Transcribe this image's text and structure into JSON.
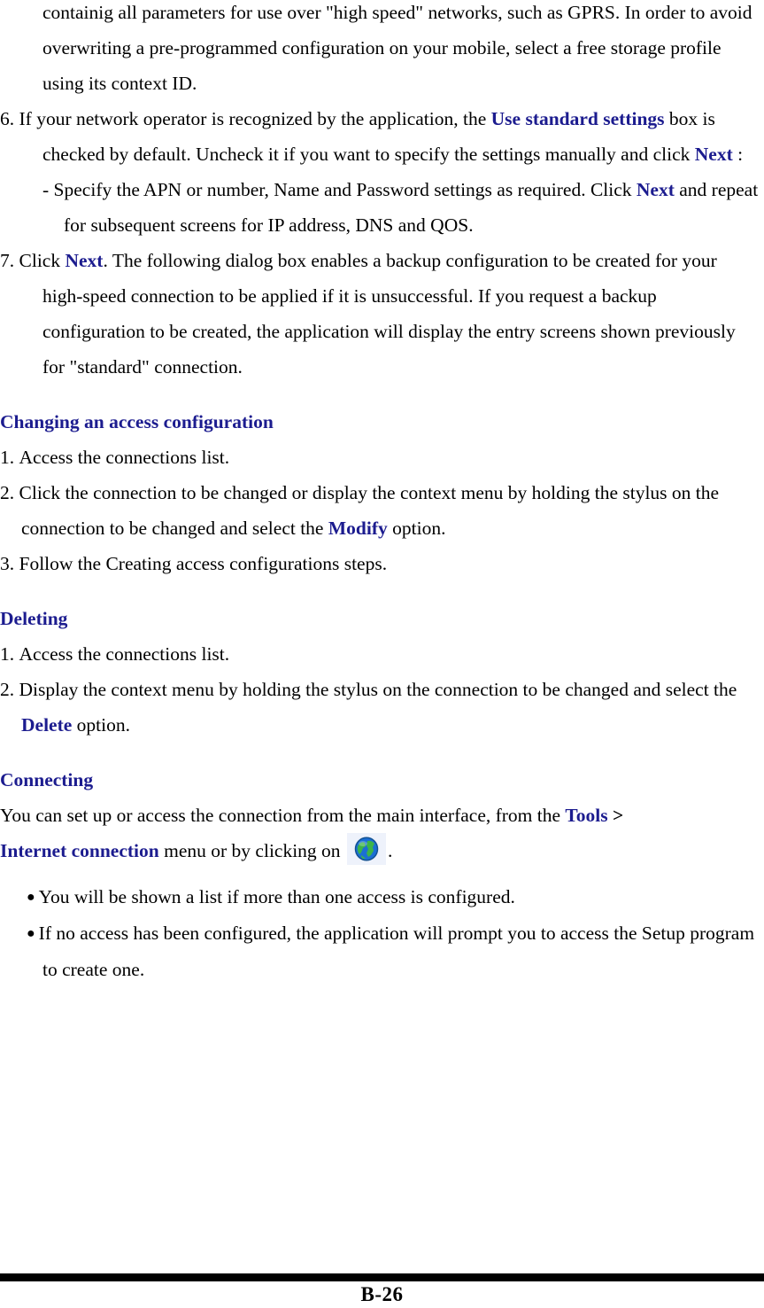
{
  "document": {
    "page_label": "B-26"
  },
  "body": {
    "continued_paragraph": {
      "line_1": "containig all parameters for use over \"high speed\" networks, such as GPRS. In",
      "line_2": "order to avoid overwriting a pre-programmed configuration on your mobile,",
      "line_3": "select a free storage profile using its context ID.",
      "full_text": "containig all parameters for use over \"high speed\" networks, such as GPRS. In order to avoid overwriting a pre-programmed configuration on your mobile, select a free storage profile using its context ID."
    },
    "step_6": {
      "number": "6.",
      "text_before_bold_1": "If your network operator is recognized by the application, the ",
      "bold_1": "Use standard settings",
      "text_middle": " box is checked by default. Uncheck it if you want to specify the settings manually and click ",
      "bold_2": "Next",
      "text_after": " :",
      "sub_item": {
        "dash": "-",
        "text_before_bold": "Specify the APN or number, Name and Password settings as required. Click ",
        "bold": "Next",
        "text_after": " and repeat for subsequent screens for IP address, DNS and QOS."
      }
    },
    "step_7": {
      "number": "7.",
      "text_before_bold": "Click ",
      "bold": "Next",
      "text_after": ". The following dialog box enables a backup configuration to be created for your high-speed connection to be applied if it is unsuccessful. If you request a backup configuration to be created, the application will display the entry screens shown previously for \"standard\" connection."
    },
    "section_changing": {
      "heading": "Changing an access configuration",
      "item_1": {
        "number": "1.",
        "text": "Access the connections list."
      },
      "item_2": {
        "number": "2.",
        "text_before_bold": "Click the connection to be changed or display the context menu by holding the stylus on the connection to be changed and select the ",
        "bold": "Modify",
        "text_after": " option."
      },
      "item_3": {
        "number": "3.",
        "text": "Follow the Creating access configurations steps."
      }
    },
    "section_deleting": {
      "heading": "Deleting",
      "item_1": {
        "number": "1.",
        "text": "Access the connections list."
      },
      "item_2": {
        "number": "2.",
        "text_before_bold": "Display the context menu by holding the stylus on the connection to be changed and select the ",
        "bold": "Delete",
        "text_after": " option."
      }
    },
    "section_connecting": {
      "heading": "Connecting",
      "paragraph": {
        "text_before_bold_1": "You can set up or access the connection from the main interface, from the ",
        "bold_1": "Tools",
        "separator": " >",
        "bold_2": "Internet connection",
        "text_middle": " menu or by clicking on ",
        "icon_name": "globe-icon",
        "text_after": "."
      },
      "bullets": [
        {
          "marker": "●",
          "text": "You will be shown a list if more than one access is configured."
        },
        {
          "marker": "●",
          "text": "If no access has been configured, the application will prompt you to access the Setup program to create one."
        }
      ]
    }
  },
  "colors": {
    "heading_blue": "#1c1c8f",
    "body_black": "#000000",
    "page_background": "#ffffff",
    "footer_rule": "#000000",
    "icon_background": "#eef2fb",
    "globe_ocean": "#1b6fd4",
    "globe_land": "#3cb44a"
  }
}
